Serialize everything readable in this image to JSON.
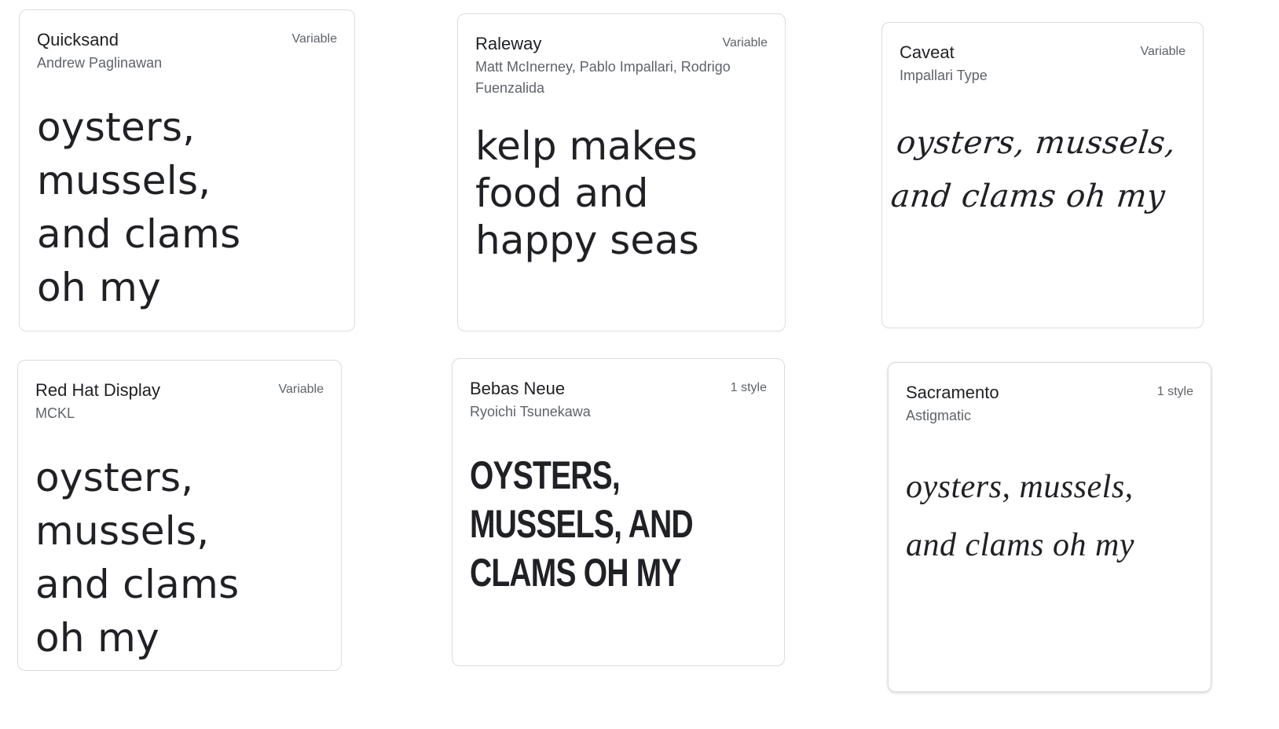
{
  "cards": [
    {
      "font_name": "Quicksand",
      "designer": "Andrew Paglinawan",
      "styles": "Variable",
      "sample": "oysters, mussels, and clams oh my"
    },
    {
      "font_name": "Raleway",
      "designer": "Matt McInerney, Pablo Impallari, Rodrigo Fuenzalida",
      "styles": "Variable",
      "sample": "kelp makes food and happy seas"
    },
    {
      "font_name": "Caveat",
      "designer": "Impallari Type",
      "styles": "Variable",
      "sample": "oysters, mussels, and clams oh my"
    },
    {
      "font_name": "Red Hat Display",
      "designer": "MCKL",
      "styles": "Variable",
      "sample": "oysters, mussels, and clams oh my"
    },
    {
      "font_name": "Bebas Neue",
      "designer": "Ryoichi Tsunekawa",
      "styles": "1 style",
      "sample": "OYSTERS, MUSSELS, AND CLAMS OH MY"
    },
    {
      "font_name": "Sacramento",
      "designer": "Astigmatic",
      "styles": "1 style",
      "sample": "oysters, mussels, and clams oh my"
    }
  ]
}
